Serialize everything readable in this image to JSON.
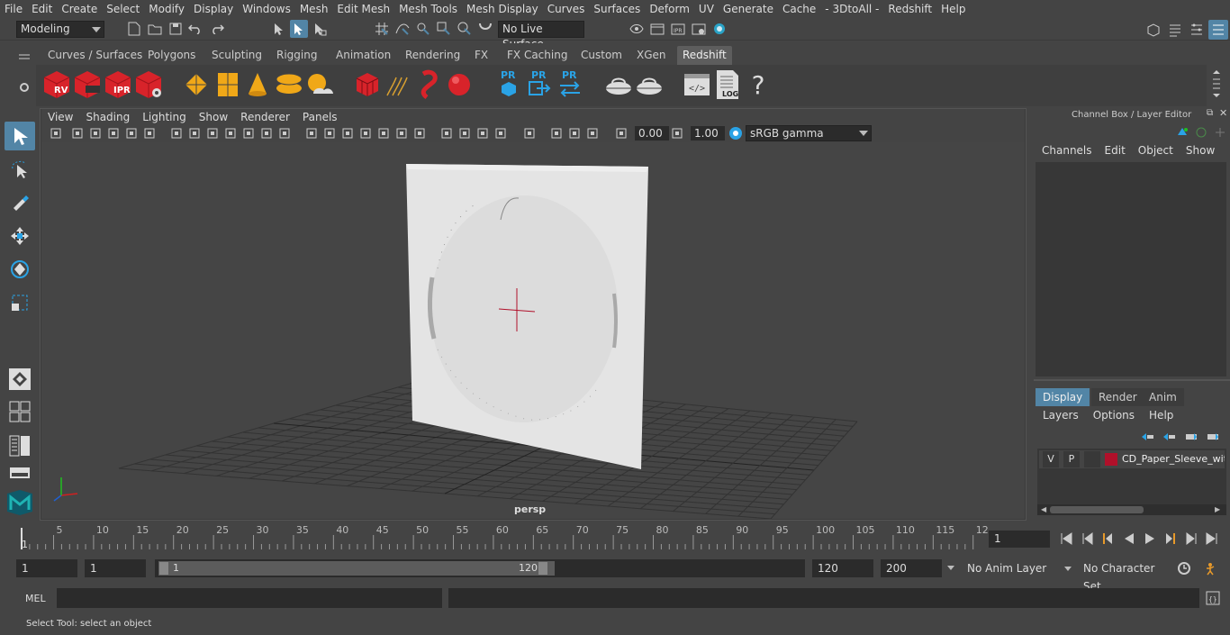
{
  "menubar": {
    "items": [
      "File",
      "Edit",
      "Create",
      "Select",
      "Modify",
      "Display",
      "Windows",
      "Mesh",
      "Edit Mesh",
      "Mesh Tools",
      "Mesh Display",
      "Curves",
      "Surfaces",
      "Deform",
      "UV",
      "Generate",
      "Cache",
      "- 3DtoAll -",
      "Redshift",
      "Help"
    ]
  },
  "statusline": {
    "mode": "Modeling",
    "live_surface": "No Live Surface"
  },
  "shelf": {
    "tabs": [
      "Curves / Surfaces",
      "Polygons",
      "Sculpting",
      "Rigging",
      "Animation",
      "Rendering",
      "FX",
      "FX Caching",
      "Custom",
      "XGen",
      "Redshift"
    ],
    "active_tab": "Redshift",
    "icons": {
      "rv": "RV",
      "ipr": "IPR",
      "pr1": "PR",
      "pr2": "PR",
      "pr3": "PR",
      "log": "LOG",
      "help": "?"
    }
  },
  "viewport": {
    "menu": [
      "View",
      "Shading",
      "Lighting",
      "Show",
      "Renderer",
      "Panels"
    ],
    "exposure": "0.00",
    "gamma": "1.00",
    "color_space": "sRGB gamma",
    "camera_label": "persp"
  },
  "channel_box": {
    "title": "Channel Box / Layer Editor",
    "menu": [
      "Channels",
      "Edit",
      "Object",
      "Show"
    ]
  },
  "layer_editor": {
    "tabs": [
      "Display",
      "Render",
      "Anim"
    ],
    "active_tab": "Display",
    "menu": [
      "Layers",
      "Options",
      "Help"
    ],
    "layer": {
      "v": "V",
      "p": "P",
      "name": "CD_Paper_Sleeve_with",
      "color": "#b0102a"
    }
  },
  "timeline": {
    "ticks": [
      "5",
      "10",
      "15",
      "20",
      "25",
      "30",
      "35",
      "40",
      "45",
      "50",
      "55",
      "60",
      "65",
      "70",
      "75",
      "80",
      "85",
      "90",
      "95",
      "100",
      "105",
      "110",
      "115",
      "12"
    ],
    "start_marker": "1",
    "current_frame": "1"
  },
  "range": {
    "start": "1",
    "playback_start": "1",
    "slider_start": "1",
    "slider_end": "120",
    "playback_end": "120",
    "end": "200",
    "anim_layer": "No Anim Layer",
    "character_set": "No Character Set"
  },
  "command_line": {
    "label": "MEL"
  },
  "help_line": {
    "text": "Select Tool: select an object"
  },
  "colors": {
    "accent": "#5285a6",
    "redshift_red": "#d8232a",
    "maya_teal": "#1fb3b3"
  }
}
